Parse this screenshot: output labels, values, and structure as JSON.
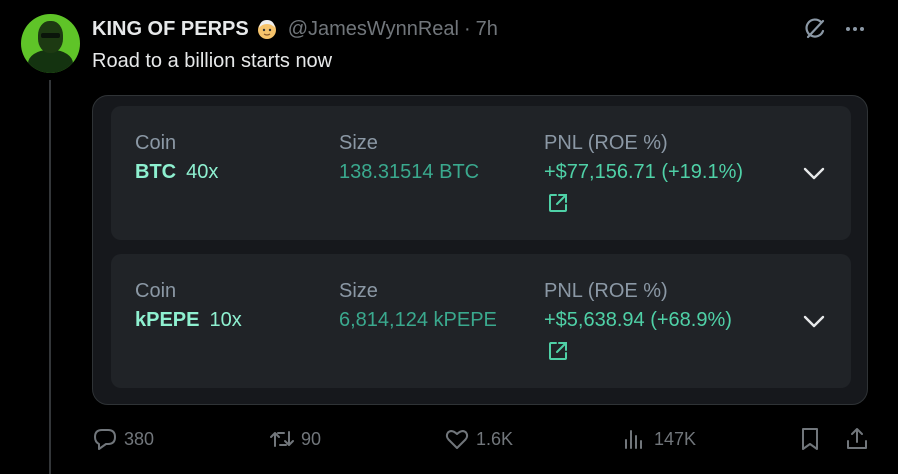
{
  "colors": {
    "background": "#000000",
    "card": "#16181c",
    "row": "#202327",
    "label": "#8b98a5",
    "coin": "#8ef0d0",
    "size": "#3aa98e",
    "pnl": "#4fd1a7",
    "muted": "#71767b"
  },
  "post": {
    "author_name": "KING OF PERPS",
    "badge_icon": "old-man-emoji",
    "handle": "@JamesWynnReal",
    "separator": "·",
    "time": "7h",
    "text": "Road to a billion starts now"
  },
  "positions": [
    {
      "coin_label": "Coin",
      "size_label": "Size",
      "pnl_label": "PNL (ROE %)",
      "coin": "BTC",
      "leverage": "40x",
      "size": "138.31514 BTC",
      "pnl": "+$77,156.71 (+19.1%)",
      "link_icon": "external-link-icon",
      "expand_icon": "chevron-down-icon"
    },
    {
      "coin_label": "Coin",
      "size_label": "Size",
      "pnl_label": "PNL (ROE %)",
      "coin": "kPEPE",
      "leverage": "10x",
      "size": "6,814,124 kPEPE",
      "pnl": "+$5,638.94 (+68.9%)",
      "link_icon": "external-link-icon",
      "expand_icon": "chevron-down-icon"
    }
  ],
  "actions": {
    "replies": "380",
    "reposts": "90",
    "likes": "1.6K",
    "views": "147K"
  },
  "icons": [
    "grok-icon",
    "more-icon",
    "reply-icon",
    "repost-icon",
    "like-icon",
    "views-icon",
    "bookmark-icon",
    "share-icon"
  ]
}
